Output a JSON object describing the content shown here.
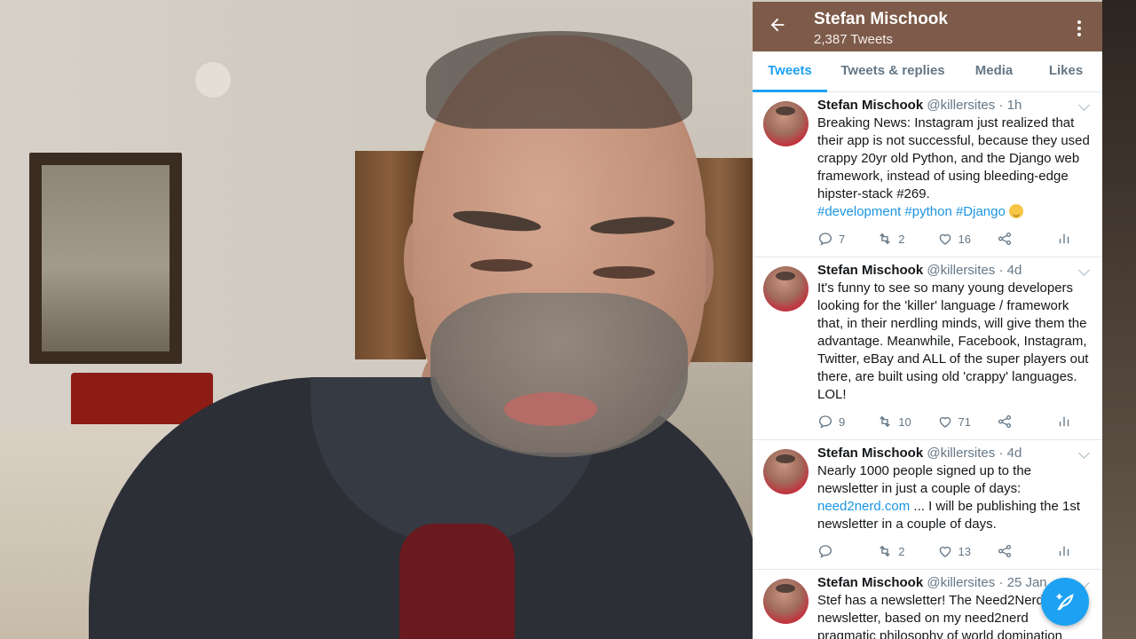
{
  "profile": {
    "name": "Stefan Mischook",
    "tweet_count": "2,387 Tweets"
  },
  "tabs": [
    {
      "label": "Tweets",
      "active": true
    },
    {
      "label": "Tweets & replies",
      "active": false
    },
    {
      "label": "Media",
      "active": false
    },
    {
      "label": "Likes",
      "active": false
    }
  ],
  "colors": {
    "topbar": "#7d5a49",
    "accent": "#1da1f2",
    "link": "#1b95e0"
  },
  "icons": {
    "back": "arrow-left-icon",
    "more": "more-vertical-icon",
    "reply": "reply-icon",
    "retweet": "retweet-icon",
    "like": "heart-icon",
    "share": "share-icon",
    "analytics": "analytics-icon",
    "compose": "compose-tweet-icon"
  },
  "tweets": [
    {
      "author": "Stefan Mischook",
      "handle": "@killersites",
      "time": "1h",
      "text": "Breaking News: Instagram just realized that their app is not successful, because they used crappy 20yr old Python, and the Django web framework, instead of using bleeding-edge hipster-stack #269.",
      "hashtags": "#development #python #Django",
      "replies": "7",
      "retweets": "2",
      "likes": "16"
    },
    {
      "author": "Stefan Mischook",
      "handle": "@killersites",
      "time": "4d",
      "text": "It's funny to see so many young developers looking for the 'killer' language / framework that, in their nerdling minds, will give them the advantage. Meanwhile, Facebook, Instagram, Twitter, eBay and ALL of the super players out there, are built using old 'crappy' languages. LOL!",
      "replies": "9",
      "retweets": "10",
      "likes": "71"
    },
    {
      "author": "Stefan Mischook",
      "handle": "@killersites",
      "time": "4d",
      "text_before": "Nearly 1000 people signed up to the newsletter in just a couple of days:",
      "link": "need2nerd.com",
      "text_after": "... I will be publishing the 1st newsletter in a couple of days.",
      "replies": "",
      "retweets": "2",
      "likes": "13"
    },
    {
      "author": "Stefan Mischook",
      "handle": "@killersites",
      "time": "25 Jan",
      "text": "Stef has a newsletter! The Need2Nerd newsletter, based on my need2nerd pragmatic philosophy of world domination"
    }
  ]
}
